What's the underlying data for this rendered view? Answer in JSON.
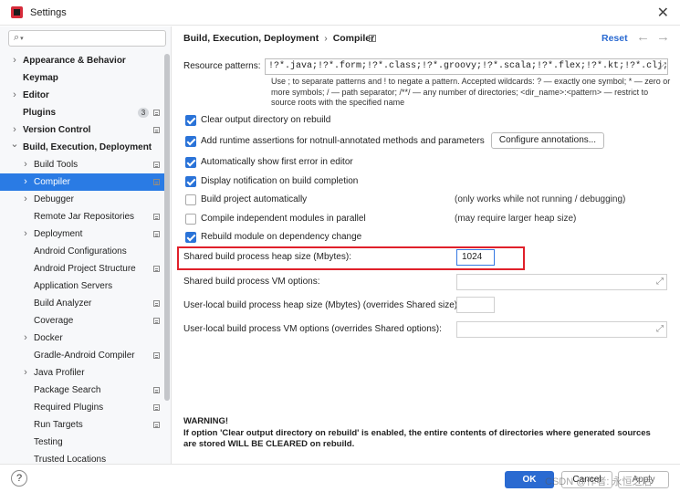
{
  "window": {
    "title": "Settings"
  },
  "sidebar": {
    "search": {
      "value": "",
      "placeholder": ""
    },
    "items": [
      {
        "label": "Appearance & Behavior",
        "level": 0,
        "chevron": "right",
        "bold": true,
        "selected": false,
        "badge": "",
        "project_icon": false
      },
      {
        "label": "Keymap",
        "level": 0,
        "chevron": "none",
        "bold": true,
        "selected": false,
        "badge": "",
        "project_icon": false
      },
      {
        "label": "Editor",
        "level": 0,
        "chevron": "right",
        "bold": true,
        "selected": false,
        "badge": "",
        "project_icon": false
      },
      {
        "label": "Plugins",
        "level": 0,
        "chevron": "none",
        "bold": true,
        "selected": false,
        "badge": "3",
        "project_icon": true
      },
      {
        "label": "Version Control",
        "level": 0,
        "chevron": "right",
        "bold": true,
        "selected": false,
        "badge": "",
        "project_icon": true
      },
      {
        "label": "Build, Execution, Deployment",
        "level": 0,
        "chevron": "down",
        "bold": true,
        "selected": false,
        "badge": "",
        "project_icon": false
      },
      {
        "label": "Build Tools",
        "level": 1,
        "chevron": "right",
        "bold": false,
        "selected": false,
        "badge": "",
        "project_icon": true
      },
      {
        "label": "Compiler",
        "level": 1,
        "chevron": "right",
        "bold": false,
        "selected": true,
        "badge": "",
        "project_icon": true
      },
      {
        "label": "Debugger",
        "level": 1,
        "chevron": "right",
        "bold": false,
        "selected": false,
        "badge": "",
        "project_icon": false
      },
      {
        "label": "Remote Jar Repositories",
        "level": 1,
        "chevron": "none",
        "bold": false,
        "selected": false,
        "badge": "",
        "project_icon": true
      },
      {
        "label": "Deployment",
        "level": 1,
        "chevron": "right",
        "bold": false,
        "selected": false,
        "badge": "",
        "project_icon": true
      },
      {
        "label": "Android Configurations",
        "level": 1,
        "chevron": "none",
        "bold": false,
        "selected": false,
        "badge": "",
        "project_icon": false
      },
      {
        "label": "Android Project Structure",
        "level": 1,
        "chevron": "none",
        "bold": false,
        "selected": false,
        "badge": "",
        "project_icon": true
      },
      {
        "label": "Application Servers",
        "level": 1,
        "chevron": "none",
        "bold": false,
        "selected": false,
        "badge": "",
        "project_icon": false
      },
      {
        "label": "Build Analyzer",
        "level": 1,
        "chevron": "none",
        "bold": false,
        "selected": false,
        "badge": "",
        "project_icon": true
      },
      {
        "label": "Coverage",
        "level": 1,
        "chevron": "none",
        "bold": false,
        "selected": false,
        "badge": "",
        "project_icon": true
      },
      {
        "label": "Docker",
        "level": 1,
        "chevron": "right",
        "bold": false,
        "selected": false,
        "badge": "",
        "project_icon": false
      },
      {
        "label": "Gradle-Android Compiler",
        "level": 1,
        "chevron": "none",
        "bold": false,
        "selected": false,
        "badge": "",
        "project_icon": true
      },
      {
        "label": "Java Profiler",
        "level": 1,
        "chevron": "right",
        "bold": false,
        "selected": false,
        "badge": "",
        "project_icon": false
      },
      {
        "label": "Package Search",
        "level": 1,
        "chevron": "none",
        "bold": false,
        "selected": false,
        "badge": "",
        "project_icon": true
      },
      {
        "label": "Required Plugins",
        "level": 1,
        "chevron": "none",
        "bold": false,
        "selected": false,
        "badge": "",
        "project_icon": true
      },
      {
        "label": "Run Targets",
        "level": 1,
        "chevron": "none",
        "bold": false,
        "selected": false,
        "badge": "",
        "project_icon": true
      },
      {
        "label": "Testing",
        "level": 1,
        "chevron": "none",
        "bold": false,
        "selected": false,
        "badge": "",
        "project_icon": false
      },
      {
        "label": "Trusted Locations",
        "level": 1,
        "chevron": "none",
        "bold": false,
        "selected": false,
        "badge": "",
        "project_icon": false
      }
    ]
  },
  "header": {
    "breadcrumb": [
      "Build, Execution, Deployment",
      "Compiler"
    ],
    "reset_label": "Reset",
    "back_glyph": "←",
    "forward_glyph": "→"
  },
  "compiler": {
    "resource_patterns_label": "Resource patterns:",
    "resource_patterns_value": "!?*.java;!?*.form;!?*.class;!?*.groovy;!?*.scala;!?*.flex;!?*.kt;!?*.clj;!?*.aj",
    "resource_help": {
      "line1": "Use ; to separate patterns and ! to negate a pattern. Accepted wildcards: ? — exactly one symbol; * — zero or",
      "line2": "more symbols; / — path separator; /**/ — any number of directories; <dir_name>:<pattern> — restrict to",
      "line3": "source roots with the specified name"
    },
    "options": [
      {
        "label": "Clear output directory on rebuild",
        "checked": true,
        "hint": ""
      },
      {
        "label": "Add runtime assertions for notnull-annotated methods and parameters",
        "checked": true,
        "hint": ""
      },
      {
        "label": "Automatically show first error in editor",
        "checked": true,
        "hint": ""
      },
      {
        "label": "Display notification on build completion",
        "checked": true,
        "hint": ""
      },
      {
        "label": "Build project automatically",
        "checked": false,
        "hint": "(only works while not running / debugging)"
      },
      {
        "label": "Compile independent modules in parallel",
        "checked": false,
        "hint": "(may require larger heap size)"
      },
      {
        "label": "Rebuild module on dependency change",
        "checked": true,
        "hint": ""
      }
    ],
    "configure_annotations_label": "Configure annotations...",
    "heap_size_label": "Shared build process heap size (Mbytes):",
    "heap_size_value": "1024",
    "vm_options_label": "Shared build process VM options:",
    "vm_options_value": "",
    "user_heap_label": "User-local build process heap size (Mbytes) (overrides Shared size):",
    "user_heap_value": "",
    "user_vm_label": "User-local build process VM options (overrides Shared options):",
    "user_vm_value": "",
    "warning_title": "WARNING!",
    "warning_line1": "If option 'Clear output directory on rebuild' is enabled, the entire contents of directories where generated sources",
    "warning_line2": "are stored WILL BE CLEARED on rebuild."
  },
  "footer": {
    "help_label": "?",
    "ok_label": "OK",
    "cancel_label": "Cancel",
    "apply_label": "Apply",
    "watermark": "CSDN @作者: 永恒之后"
  },
  "colors": {
    "accent": "#2a6ad1",
    "selection": "#2a7be4",
    "highlight_border": "#e0202a"
  }
}
